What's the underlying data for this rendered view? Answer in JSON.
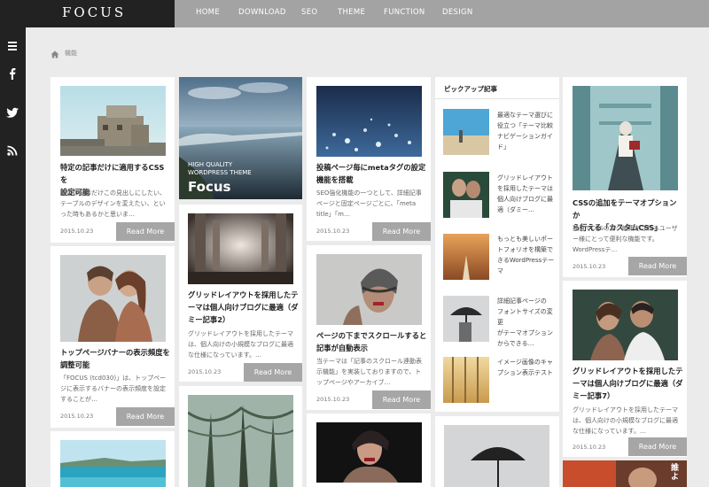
{
  "header": {
    "logo": "FOCUS",
    "nav": [
      "HOME",
      "DOWNLOAD",
      "SEO",
      "THEME",
      "FUNCTION",
      "DESIGN"
    ]
  },
  "sidebar": {
    "icons": [
      "menu-icon",
      "facebook-icon",
      "twitter-icon",
      "rss-icon"
    ]
  },
  "breadcrumb": {
    "home_icon": "home-icon",
    "label": "機能"
  },
  "featured": {
    "subtitle_line1": "HIGH QUALITY",
    "subtitle_line2": "WORDPRESS THEME",
    "title": "Focus"
  },
  "cards": {
    "c1": {
      "title_l1": "特定の記事だけに適用するCSSを",
      "title_l2": "設定可能",
      "ex_l1": "特定の記事だけこの見出しにしたい、",
      "ex_l2": "テーブルのデザインを変えたい、とい",
      "ex_l3": "った時もあるかと思いま…",
      "date": "2015.10.23",
      "more": "Read More"
    },
    "c2": {
      "title_l1": "トップページバナーの表示頻度を",
      "title_l2": "調整可能",
      "ex_l1": "「FOCUS (tcd030)」は、トップペー",
      "ex_l2": "ジに表示するバナーの表示頻度を設定",
      "ex_l3": "することが…",
      "date": "2015.10.23",
      "more": "Read More"
    },
    "c3": {
      "title_l1": "グリッドレイアウトを採用したテ",
      "title_l2": "ーマは個人向けブログに最適（ダ",
      "title_l3": "ミー記事2）",
      "ex_l1": "グリッドレイアウトを採用したテーマ",
      "ex_l2": "は、個人向けの小規模なブログに最適",
      "ex_l3": "な仕様になっています。…",
      "date": "2015.10.23",
      "more": "Read More"
    },
    "c4": {
      "title_l1": "投稿ページ毎にmetaタグの設定",
      "title_l2": "機能を搭載",
      "ex_l1": "SEO強化機能の一つとして、詳細記事",
      "ex_l2": "ページと固定ページごとに、「meta",
      "ex_l3": "title」「m…",
      "date": "2015.10.23",
      "more": "Read More"
    },
    "c5": {
      "title_l1": "ページの下までスクロールすると",
      "title_l2": "記事が自動表示",
      "ex_l1": "当テーマは「記事のスクロール連動表",
      "ex_l2": "示機能」を実装しておりますので、ト",
      "ex_l3": "ップページやアーカイブ…",
      "date": "2015.10.23",
      "more": "Read More"
    },
    "c6": {
      "title_l1": "CSSの追加をテーマオプションか",
      "title_l2": "ら行える「カスタムCSS」",
      "ex_l1": "独自でCSSのタグ編集をされるユーザ",
      "ex_l2": "ー様にとって便利な機能です。",
      "ex_l3": "WordPressテ…",
      "date": "2015.10.23",
      "more": "Read More"
    },
    "c7": {
      "title_l1": "グリッドレイアウトを採用したテ",
      "title_l2": "ーマは個人向けブログに最適（ダ",
      "title_l3": "ミー記事7）",
      "ex_l1": "グリッドレイアウトを採用したテーマ",
      "ex_l2": "は、個人向けの小規模なブログに最適",
      "ex_l3": "な仕様になっています。…",
      "date": "2015.10.23",
      "more": "Read More"
    }
  },
  "pickup": {
    "heading": "ピックアップ記事",
    "items": [
      {
        "l1": "最適なテーマ選びに",
        "l2": "役立つ「テーマ比較",
        "l3": "ナビゲーションガイ",
        "l4": "ド」"
      },
      {
        "l1": "グリッドレイアウト",
        "l2": "を採用したテーマは",
        "l3": "個人向けブログに最",
        "l4": "適（ダミー…"
      },
      {
        "l1": "もっとも美しいポー",
        "l2": "トフォリオを構築で",
        "l3": "きるWordPressテー",
        "l4": "マ"
      },
      {
        "l1": "詳細記事ページの",
        "l2": "フォントサイズの変更",
        "l3": "がテーマオプション",
        "l4": "からできる…"
      },
      {
        "l1": "イメージ画像のキャ",
        "l2": "プション表示テスト",
        "l3": "",
        "l4": ""
      }
    ]
  },
  "overlay_text": "誰よ"
}
